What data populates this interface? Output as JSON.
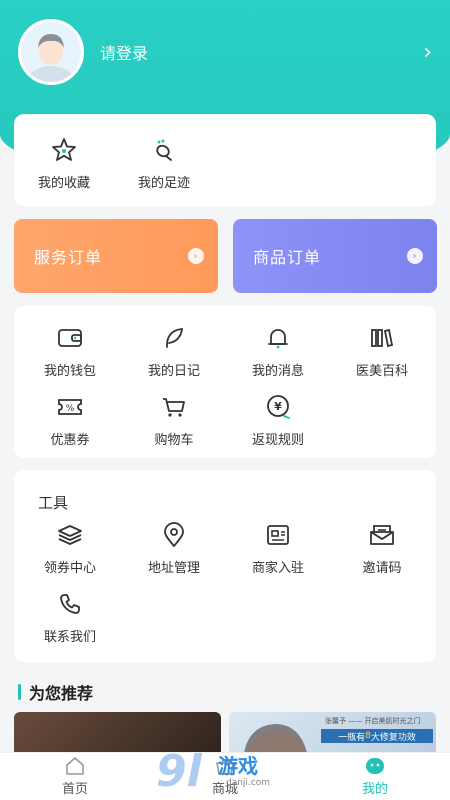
{
  "profile": {
    "login_label": "请登录",
    "arrow": "›"
  },
  "quick": [
    {
      "label": "我的收藏",
      "icon": "star-icon"
    },
    {
      "label": "我的足迹",
      "icon": "footprint-icon"
    }
  ],
  "orders": [
    {
      "label": "服务订单",
      "color": "#ff9a5a"
    },
    {
      "label": "商品订单",
      "color": "#7c83ef"
    }
  ],
  "services": [
    {
      "label": "我的钱包",
      "icon": "wallet-icon"
    },
    {
      "label": "我的日记",
      "icon": "feather-icon"
    },
    {
      "label": "我的消息",
      "icon": "bell-icon"
    },
    {
      "label": "医美百科",
      "icon": "books-icon"
    },
    {
      "label": "优惠券",
      "icon": "coupon-icon"
    },
    {
      "label": "购物车",
      "icon": "cart-icon"
    },
    {
      "label": "返现规则",
      "icon": "cashback-icon"
    }
  ],
  "tools": {
    "title": "工具",
    "items": [
      {
        "label": "领券中心",
        "icon": "layers-icon"
      },
      {
        "label": "地址管理",
        "icon": "location-icon"
      },
      {
        "label": "商家入驻",
        "icon": "merchant-icon"
      },
      {
        "label": "邀请码",
        "icon": "envelope-icon"
      },
      {
        "label": "联系我们",
        "icon": "phone-icon"
      }
    ]
  },
  "recommend": {
    "title": "为您推荐",
    "promo_small": "张馨予 —— 开启美肌时光之门",
    "promo_banner_pre": "一瓶有",
    "promo_banner_num": "8",
    "promo_banner_post": "大修复功效"
  },
  "tabbar": [
    {
      "label": "首页",
      "icon": "home-icon",
      "active": false
    },
    {
      "label": "商城",
      "icon": "shop-icon",
      "active": false
    },
    {
      "label": "我的",
      "icon": "me-icon",
      "active": true
    }
  ],
  "watermark": {
    "num": "9l",
    "text": "游戏",
    "url": "danji.com"
  },
  "colors": {
    "teal": "#22c3b7",
    "orange": "#ff9a5a",
    "purple": "#7c83ef"
  }
}
